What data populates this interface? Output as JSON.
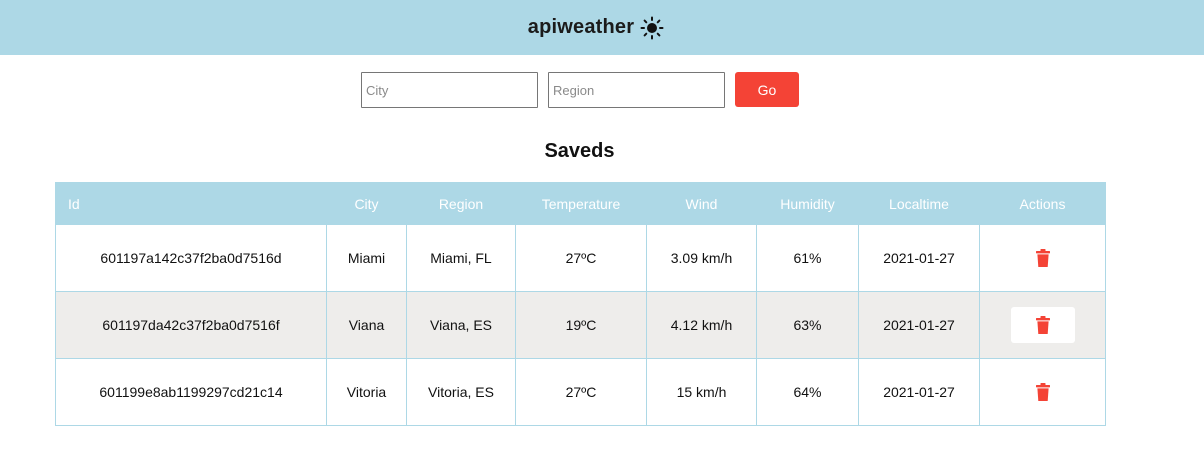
{
  "header": {
    "title": "apiweather",
    "icon": "sun-icon"
  },
  "search": {
    "city_placeholder": "City",
    "region_placeholder": "Region",
    "city_value": "",
    "region_value": "",
    "go_label": "Go"
  },
  "saved": {
    "title": "Saveds",
    "columns": [
      "Id",
      "City",
      "Region",
      "Temperature",
      "Wind",
      "Humidity",
      "Localtime",
      "Actions"
    ],
    "rows": [
      {
        "id": "601197a142c37f2ba0d7516d",
        "city": "Miami",
        "region": "Miami, FL",
        "temperature": "27ºC",
        "wind": "3.09 km/h",
        "humidity": "61%",
        "localtime": "2021-01-27"
      },
      {
        "id": "601197da42c37f2ba0d7516f",
        "city": "Viana",
        "region": "Viana, ES",
        "temperature": "19ºC",
        "wind": "4.12 km/h",
        "humidity": "63%",
        "localtime": "2021-01-27"
      },
      {
        "id": "601199e8ab1199297cd21c14",
        "city": "Vitoria",
        "region": "Vitoria, ES",
        "temperature": "27ºC",
        "wind": "15 km/h",
        "humidity": "64%",
        "localtime": "2021-01-27"
      }
    ],
    "action_icon": "trash-icon"
  },
  "colors": {
    "header_bg": "#add8e6",
    "accent_red": "#f44336",
    "row_alt_bg": "#eeedeb"
  }
}
